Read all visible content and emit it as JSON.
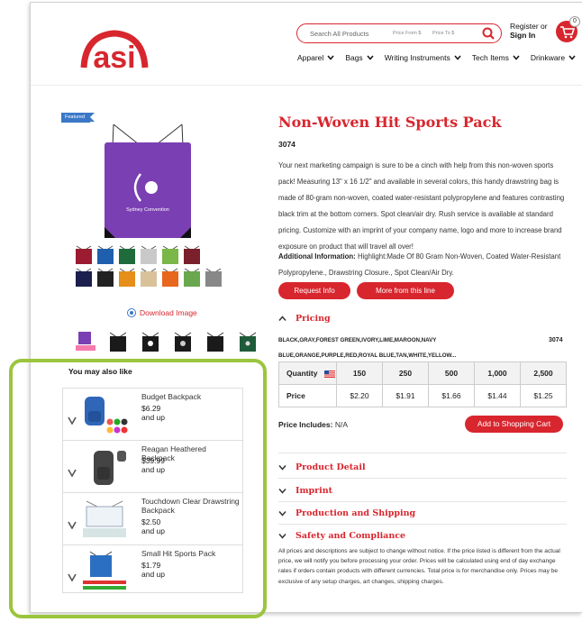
{
  "header": {
    "search": {
      "placeholder": "Search All Products",
      "price_from": "Price From $",
      "price_to": "Price To $"
    },
    "signin": {
      "line1": "Register or",
      "line2": "Sign In"
    },
    "cart_count": "0",
    "nav": [
      "Apparel",
      "Bags",
      "Writing Instruments",
      "Tech Items",
      "Drinkware"
    ]
  },
  "gallery": {
    "badge": "Featured",
    "bag_text": "Sydney Convention",
    "bag_color": "#7a3fb3",
    "swatch_colors_row1": [
      "#9b1b30",
      "#1f5fae",
      "#1f6b3c",
      "#c9c9c9",
      "#7ab648",
      "#7a1f2c"
    ],
    "swatch_colors_row2": [
      "#1a1f4d",
      "#222222",
      "#e58e1a",
      "#d9c29a",
      "#e8671e",
      "#6aa84f",
      "#888888"
    ],
    "download_label": "Download Image"
  },
  "may_also_like": {
    "title": "You may also like",
    "items": [
      {
        "name": "Budget Backpack",
        "price": "$6.29",
        "suffix": "and up"
      },
      {
        "name": "Reagan Heathered Backpack",
        "price": "$39.99",
        "suffix": "and up"
      },
      {
        "name": "Touchdown Clear Drawstring Backpack",
        "price": "$2.50",
        "suffix": "and up"
      },
      {
        "name": "Small Hit Sports Pack",
        "price": "$1.79",
        "suffix": "and up"
      }
    ]
  },
  "product": {
    "title": "Non-Woven Hit Sports Pack",
    "number": "3074",
    "description": "Your next marketing campaign is sure to be a cinch with help from this non-woven sports pack! Measuring 13\" x 16 1/2\" and available in several colors, this handy drawstring bag is made of 80-gram non-woven, coated water-resistant polypropylene and features contrasting black trim at the bottom corners. Spot clean/air dry. Rush service is available at standard pricing. Customize with an imprint of your company name, logo and more to increase brand exposure on product that will travel all over!",
    "additional_label": "Additional Information:",
    "additional_text": "Highlight:Made Of 80 Gram Non-Woven, Coated Water-Resistant Polypropylene., Drawstring Closure., Spot Clean/Air Dry.",
    "btn_request": "Request Info",
    "btn_more": "More from this line"
  },
  "pricing": {
    "heading": "Pricing",
    "colors_line1": "BLACK,GRAY,FOREST GREEN,IVORY,LIME,MAROON,NAVY",
    "colors_line2": "BLUE,ORANGE,PURPLE,RED,ROYAL BLUE,TAN,WHITE,YELLOW...",
    "item_number": "3074",
    "qty_label": "Quantity",
    "price_label": "Price",
    "quantities": [
      "150",
      "250",
      "500",
      "1,000",
      "2,500"
    ],
    "prices": [
      "$2.20",
      "$1.91",
      "$1.66",
      "$1.44",
      "$1.25"
    ],
    "includes_label": "Price Includes:",
    "includes_value": "N/A",
    "add_to_cart": "Add to Shopping Cart"
  },
  "sections": [
    "Product Detail",
    "Imprint",
    "Production and Shipping",
    "Safety and Compliance"
  ],
  "disclaimer": "All prices and descriptions are subject to change without notice. If the price listed is different from the actual price, we will notify you before processing your order. Prices will be calculated using end of day exchange rates if orders contain products with different currencies. Total price is for merchandise only. Prices may be exclusive of any setup charges, art changes, shipping charges.",
  "colors": {
    "brand_red": "#d8262e",
    "highlight_green": "#9bc53d",
    "badge_blue": "#3a78c7"
  }
}
